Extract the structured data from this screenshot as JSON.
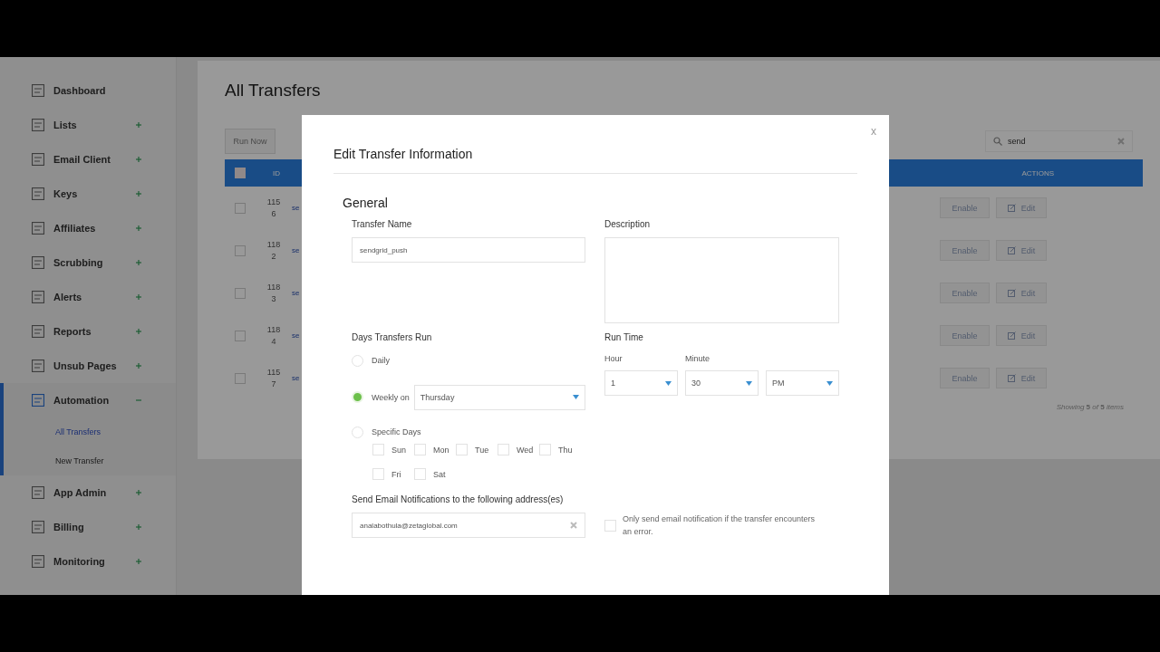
{
  "sidebar": {
    "items": [
      {
        "label": "Dashboard",
        "selected": false
      },
      {
        "label": "Lists",
        "selected": false,
        "expanded": false
      },
      {
        "label": "Email Client",
        "selected": false,
        "expanded": false
      },
      {
        "label": "Keys",
        "selected": false,
        "expanded": false
      },
      {
        "label": "Affiliates",
        "selected": false,
        "expanded": false
      },
      {
        "label": "Scrubbing",
        "selected": false,
        "expanded": false
      },
      {
        "label": "Alerts",
        "selected": false,
        "expanded": false
      },
      {
        "label": "Reports",
        "selected": false,
        "expanded": false
      },
      {
        "label": "Unsub Pages",
        "selected": false,
        "expanded": false
      },
      {
        "label": "Automation",
        "selected": true,
        "expanded": true,
        "children": [
          {
            "label": "All Transfers",
            "selected": true
          },
          {
            "label": "New Transfer",
            "selected": false
          }
        ]
      },
      {
        "label": "App Admin",
        "selected": false,
        "expanded": false
      },
      {
        "label": "Billing",
        "selected": false,
        "expanded": false
      },
      {
        "label": "Monitoring",
        "selected": false,
        "expanded": false
      }
    ]
  },
  "page": {
    "title": "All Transfers",
    "run_button": "Run Now",
    "search": {
      "value": "send"
    },
    "table": {
      "columns": [
        "ID",
        "ACTIONS"
      ],
      "all_checked": false,
      "rows": [
        {
          "id": "1156",
          "column_3": "se",
          "checked": false,
          "actions": [
            "Enable",
            "Edit"
          ]
        },
        {
          "id": "1182",
          "column_3": "se",
          "checked": false,
          "actions": [
            "Enable",
            "Edit"
          ]
        },
        {
          "id": "1183",
          "column_3": "se",
          "checked": false,
          "actions": [
            "Enable",
            "Edit"
          ]
        },
        {
          "id": "1184",
          "column_3": "se",
          "checked": false,
          "actions": [
            "Enable",
            "Edit"
          ]
        },
        {
          "id": "1157",
          "column_3": "se",
          "checked": false,
          "actions": [
            "Enable",
            "Edit"
          ]
        }
      ],
      "footer": "*Showing* **5** *of* **5** *items*"
    }
  },
  "modal": {
    "title": "Edit Transfer Information",
    "close": "x",
    "section": "General",
    "transfer_name": {
      "label": "Transfer Name",
      "value": "sendgrid_push"
    },
    "description": {
      "label": "Description"
    },
    "days": {
      "label": "Days Transfers Run",
      "options": [
        {
          "kind": "plain",
          "label": "Daily",
          "selected": false
        },
        {
          "kind": "select",
          "label": "Weekly on",
          "selected": true,
          "value": "Thursday"
        },
        {
          "kind": "days",
          "label": "Specific Days",
          "selected": false,
          "days": [
            {
              "label": "Sun",
              "checked": false
            },
            {
              "label": "Mon",
              "checked": false
            },
            {
              "label": "Tue",
              "checked": false
            },
            {
              "label": "Wed",
              "checked": false
            },
            {
              "label": "Thu",
              "checked": false
            },
            {
              "label": "Fri",
              "checked": false
            },
            {
              "label": "Sat",
              "checked": false
            }
          ]
        }
      ]
    },
    "run_time": {
      "label": "Run Time",
      "selects": [
        {
          "label": "Hour",
          "value": "1"
        },
        {
          "label": "Minute",
          "value": "30"
        },
        {
          "value": "PM"
        }
      ]
    },
    "notifications": {
      "label": "Send Email Notifications to the following address(es)",
      "value": "analabothula@zetaglobal.com"
    },
    "error_only": {
      "label": "Only send email notification if the transfer encounters an error.",
      "checked": false
    }
  }
}
